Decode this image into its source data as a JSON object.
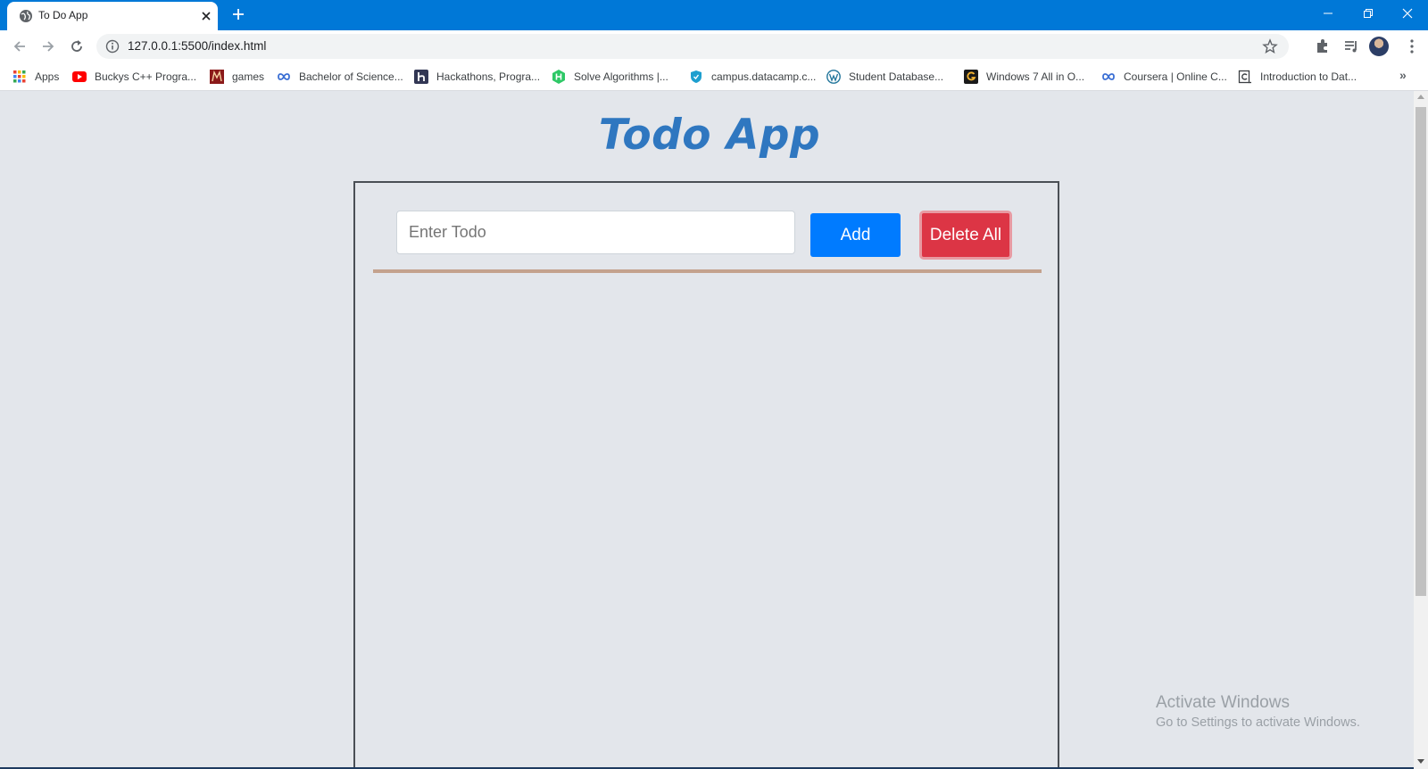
{
  "browser": {
    "tab_title": "To Do App",
    "url": "127.0.0.1:5500/index.html",
    "titlebar_color": "#0078d7"
  },
  "bookmarks": [
    {
      "label": "Apps",
      "icon": "apps-grid-icon"
    },
    {
      "label": "Buckys C++ Progra...",
      "icon": "youtube-icon"
    },
    {
      "label": "games",
      "icon": "games-icon"
    },
    {
      "label": "Bachelor of Science...",
      "icon": "infinity-icon"
    },
    {
      "label": "Hackathons, Progra...",
      "icon": "hackerearth-icon"
    },
    {
      "label": "Solve Algorithms |...",
      "icon": "hackerrank-icon"
    },
    {
      "label": "campus.datacamp.c...",
      "icon": "shield-icon"
    },
    {
      "label": "Student Database...",
      "icon": "wordpress-icon"
    },
    {
      "label": "Windows 7 All in O...",
      "icon": "g-icon"
    },
    {
      "label": "Coursera | Online C...",
      "icon": "infinity-icon"
    },
    {
      "label": "Introduction to Dat...",
      "icon": "document-c-icon"
    }
  ],
  "app": {
    "title": "Todo App",
    "input_placeholder": "Enter Todo",
    "input_value": "",
    "add_label": "Add",
    "delete_all_label": "Delete All",
    "colors": {
      "title": "#2f77c0",
      "add_button": "#007bff",
      "delete_button": "#dc3545",
      "divider": "#c4a28d"
    },
    "todos": []
  },
  "watermark": {
    "title": "Activate Windows",
    "subtitle": "Go to Settings to activate Windows."
  }
}
